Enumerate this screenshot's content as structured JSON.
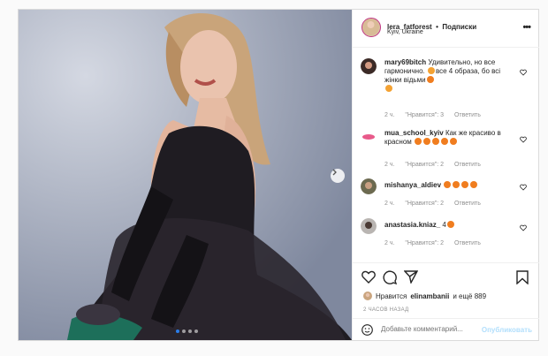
{
  "header": {
    "username": "lera_fatforest",
    "separator": "•",
    "follow_label": "Подписки",
    "location": "Kyiv, Ukraine",
    "more_label": "•••"
  },
  "comments": [
    {
      "username": "mary69bitch",
      "text_1": "Удивительно, но все гармонично.",
      "text_2": "все 4 образа, бо всі жінки відьми",
      "time": "2 ч.",
      "likes": "\"Нравится\": 3",
      "reply": "Ответить"
    },
    {
      "username": "mua_school_kyiv",
      "text_1": "Как же красиво в красном",
      "time": "2 ч.",
      "likes": "\"Нравится\": 2",
      "reply": "Ответить"
    },
    {
      "username": "mishanya_aldiev",
      "text_1": "",
      "time": "2 ч.",
      "likes": "\"Нравится\": 2",
      "reply": "Ответить"
    },
    {
      "username": "anastasia.kniaz_",
      "text_1": "4",
      "time": "2 ч.",
      "likes": "\"Нравится\": 2",
      "reply": "Ответить"
    }
  ],
  "likes": {
    "prefix": "Нравится",
    "user": "elinambanii",
    "suffix": "и ещё 889"
  },
  "time_ago": "2 ЧАСОВ НАЗАД",
  "add_comment": {
    "placeholder": "Добавьте комментарий...",
    "publish": "Опубликовать"
  },
  "carousel": {
    "slides": 4,
    "active": 1
  },
  "colors": {
    "accent": "#0095f6",
    "publish_disabled": "#b2dffc",
    "active_dot": "#2b7de9"
  }
}
